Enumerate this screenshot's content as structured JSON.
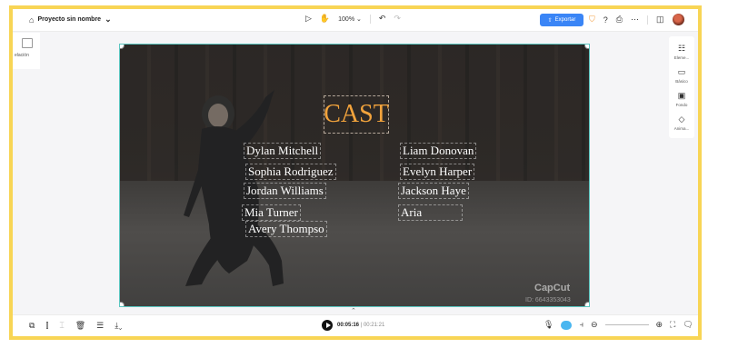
{
  "project": {
    "name": "Proyecto sin nombre"
  },
  "toolbar": {
    "zoom": "100%",
    "export_label": "Exportar"
  },
  "left_panel": {
    "label": "elación"
  },
  "right_panel": {
    "items": [
      {
        "label": "Eleme...",
        "icon": "sliders-icon"
      },
      {
        "label": "Básico",
        "icon": "basic-icon"
      },
      {
        "label": "Fondo",
        "icon": "background-icon"
      },
      {
        "label": "Anima...",
        "icon": "animation-icon"
      }
    ]
  },
  "canvas": {
    "title": "CAST",
    "names_left": [
      "Dylan Mitchell",
      "Sophia Rodriguez",
      "Jordan Williams",
      "Mia Turner",
      "Avery Thompso"
    ],
    "names_right": [
      "Liam Donovan",
      "Evelyn Harper",
      "Jackson Haye",
      "Aria"
    ],
    "watermark": "CapCut",
    "watermark_id": "ID: 6643353043"
  },
  "playback": {
    "current": "00:05:16",
    "total": "00:21:21"
  },
  "colors": {
    "accent": "#3a85f6",
    "title": "#f2a33c",
    "frame": "#f8d555"
  }
}
